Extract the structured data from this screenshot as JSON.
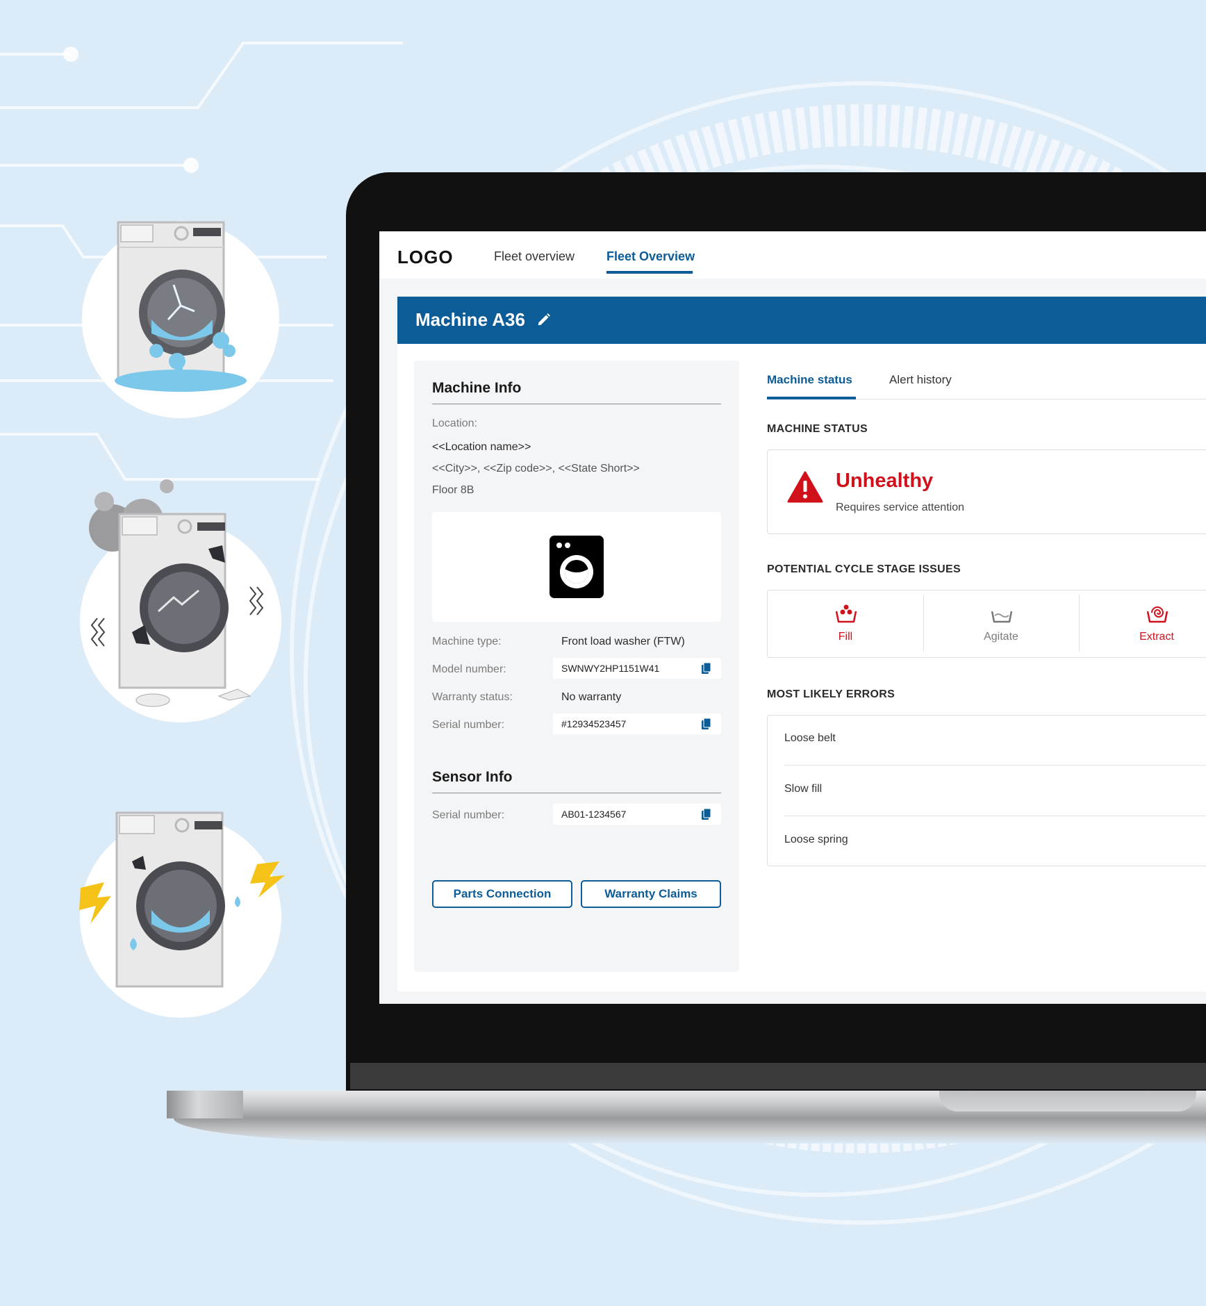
{
  "header": {
    "logo": "LOGO",
    "nav": [
      {
        "label": "Fleet overview",
        "active": false
      },
      {
        "label": "Fleet Overview",
        "active": true
      }
    ]
  },
  "machine": {
    "title": "Machine A36"
  },
  "machine_info": {
    "heading": "Machine Info",
    "location_label": "Location:",
    "location_name": "<<Location name>>",
    "location_city": "<<City>>, <<Zip code>>, <<State Short>>",
    "location_floor": "Floor 8B",
    "machine_type_label": "Machine type:",
    "machine_type_value": "Front load washer (FTW)",
    "model_label": "Model number:",
    "model_value": "SWNWY2HP1151W41",
    "warranty_label": "Warranty status:",
    "warranty_value": "No warranty",
    "serial_label": "Serial number:",
    "serial_value": "#12934523457"
  },
  "sensor_info": {
    "heading": "Sensor Info",
    "serial_label": "Serial number:",
    "serial_value": "AB01-1234567"
  },
  "buttons": {
    "parts": "Parts Connection",
    "warranty": "Warranty Claims"
  },
  "tabs": [
    {
      "label": "Machine status",
      "active": true
    },
    {
      "label": "Alert history",
      "active": false
    }
  ],
  "machine_status": {
    "heading": "MACHINE STATUS",
    "status": "Unhealthy",
    "subtext": "Requires service attention",
    "status_color": "#d0101a"
  },
  "cycle_issues": {
    "heading": "POTENTIAL CYCLE STAGE ISSUES",
    "stages": [
      {
        "label": "Fill",
        "issue": true,
        "icon": "fill-icon"
      },
      {
        "label": "Agitate",
        "issue": false,
        "icon": "agitate-icon"
      },
      {
        "label": "Extract",
        "issue": true,
        "icon": "extract-icon"
      }
    ]
  },
  "errors": {
    "heading": "MOST LIKELY ERRORS",
    "items": [
      "Loose belt",
      "Slow fill",
      "Loose spring"
    ]
  },
  "colors": {
    "brand": "#0b5c97",
    "alert": "#d0101a",
    "background": "#dcebf8"
  }
}
